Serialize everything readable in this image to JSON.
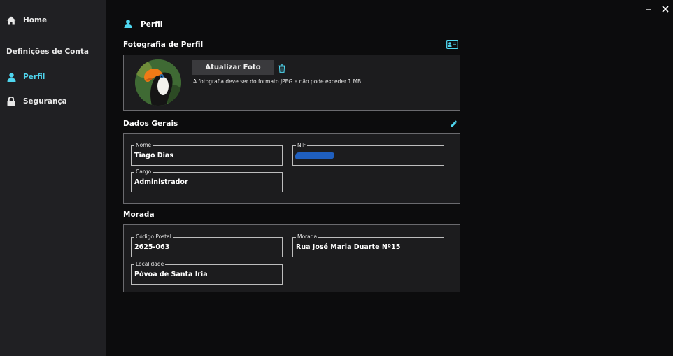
{
  "window": {
    "minimize_symbol": "—",
    "close_symbol": "✕"
  },
  "sidebar": {
    "home": {
      "label": "Home",
      "icon": "home-icon"
    },
    "section_title": "Definições de Conta",
    "items": [
      {
        "label": "Perfil",
        "icon": "user-icon",
        "active": true
      },
      {
        "label": "Segurança",
        "icon": "lock-icon",
        "active": false
      }
    ]
  },
  "page": {
    "title": "Perfil",
    "icon": "user-icon"
  },
  "photo": {
    "title": "Fotografia de Perfil",
    "card_icon": "id-card-icon",
    "upload_label": "Atualizar Foto",
    "delete_icon": "trash-icon",
    "hint": "A fotografia deve ser do formato JPEG e não pode exceder 1 MB."
  },
  "general": {
    "title": "Dados Gerais",
    "edit_icon": "pencil-icon",
    "fields": {
      "nome": {
        "label": "Nome",
        "value": "Tiago Dias"
      },
      "nif": {
        "label": "NIF",
        "value": ""
      },
      "cargo": {
        "label": "Cargo",
        "value": "Administrador"
      }
    }
  },
  "address": {
    "title": "Morada",
    "fields": {
      "postal": {
        "label": "Código Postal",
        "value": "2625-063"
      },
      "morada": {
        "label": "Morada",
        "value": "Rua José Maria Duarte Nº15"
      },
      "localidade": {
        "label": "Localidade",
        "value": "Póvoa de Santa Iria"
      }
    }
  },
  "colors": {
    "accent": "#4fd6ef",
    "sidebar_bg": "#202023",
    "panel_bg": "#1c1c1e",
    "main_bg": "#0c0c0d"
  }
}
